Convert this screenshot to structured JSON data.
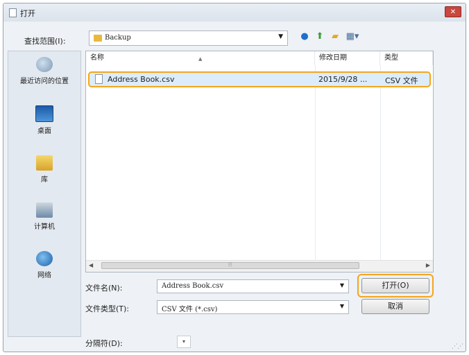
{
  "window": {
    "title": "打开",
    "close_glyph": "✕"
  },
  "toolbar": {
    "lookin_label": "查找范围(I):",
    "lookin_value": "Backup",
    "icons": [
      "back-icon",
      "up-folder-icon",
      "new-folder-icon",
      "view-menu-icon"
    ]
  },
  "places": [
    {
      "label": "最近访问的位置",
      "icon": "recent-places-icon"
    },
    {
      "label": "桌面",
      "icon": "desktop-icon"
    },
    {
      "label": "库",
      "icon": "library-icon"
    },
    {
      "label": "计算机",
      "icon": "computer-icon"
    },
    {
      "label": "网络",
      "icon": "network-icon"
    }
  ],
  "filelist": {
    "columns": [
      "名称",
      "修改日期",
      "类型"
    ],
    "rows": [
      {
        "name": "Address Book.csv",
        "date": "2015/9/28 ...",
        "type": "CSV 文件"
      }
    ]
  },
  "bottom": {
    "filename_label": "文件名(N):",
    "filename_value": "Address Book.csv",
    "filetype_label": "文件类型(T):",
    "filetype_value": "CSV 文件 (*.csv)",
    "open_label": "打开(O)",
    "cancel_label": "取消",
    "separator_label": "分隔符(D):"
  },
  "colors": {
    "highlight": "#f4a61d",
    "selection": "#dcecfb"
  }
}
